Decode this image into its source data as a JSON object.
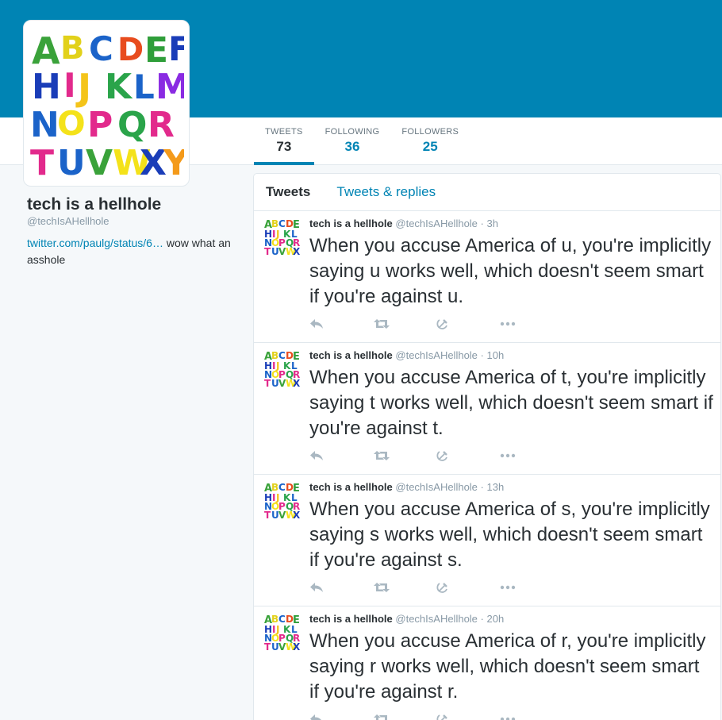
{
  "profile": {
    "name": "tech is a hellhole",
    "handle": "@techIsAHellhole",
    "bio_link": "twitter.com/paulg/status/6…",
    "bio_text": " wow what an asshole"
  },
  "stats": [
    {
      "label": "TWEETS",
      "value": "73"
    },
    {
      "label": "FOLLOWING",
      "value": "36"
    },
    {
      "label": "FOLLOWERS",
      "value": "25"
    }
  ],
  "tabs": [
    "Tweets",
    "Tweets & replies"
  ],
  "tweets": [
    {
      "name": "tech is a hellhole",
      "handle": "@techIsAHellhole",
      "time": "· 3h",
      "text": "When you accuse America of u, you're implicitly saying u works well, which doesn't seem smart if you're against u."
    },
    {
      "name": "tech is a hellhole",
      "handle": "@techIsAHellhole",
      "time": "· 10h",
      "text": "When you accuse America of t, you're implicitly saying t works well, which doesn't seem smart if you're against t."
    },
    {
      "name": "tech is a hellhole",
      "handle": "@techIsAHellhole",
      "time": "· 13h",
      "text": "When you accuse America of s, you're implicitly saying s works well, which doesn't seem smart if you're against s."
    },
    {
      "name": "tech is a hellhole",
      "handle": "@techIsAHellhole",
      "time": "· 20h",
      "text": "When you accuse America of r, you're implicitly saying r works well, which doesn't seem smart if you're against r."
    }
  ],
  "icons": {
    "reply": "reply-icon",
    "retweet": "retweet-icon",
    "favorite": "hammer-sickle-icon",
    "more": "more-icon"
  },
  "colors": {
    "banner": "#0084b4",
    "link": "#0084b4",
    "text": "#292f33",
    "muted": "#8899a6",
    "action_icon": "#aab8c2"
  }
}
